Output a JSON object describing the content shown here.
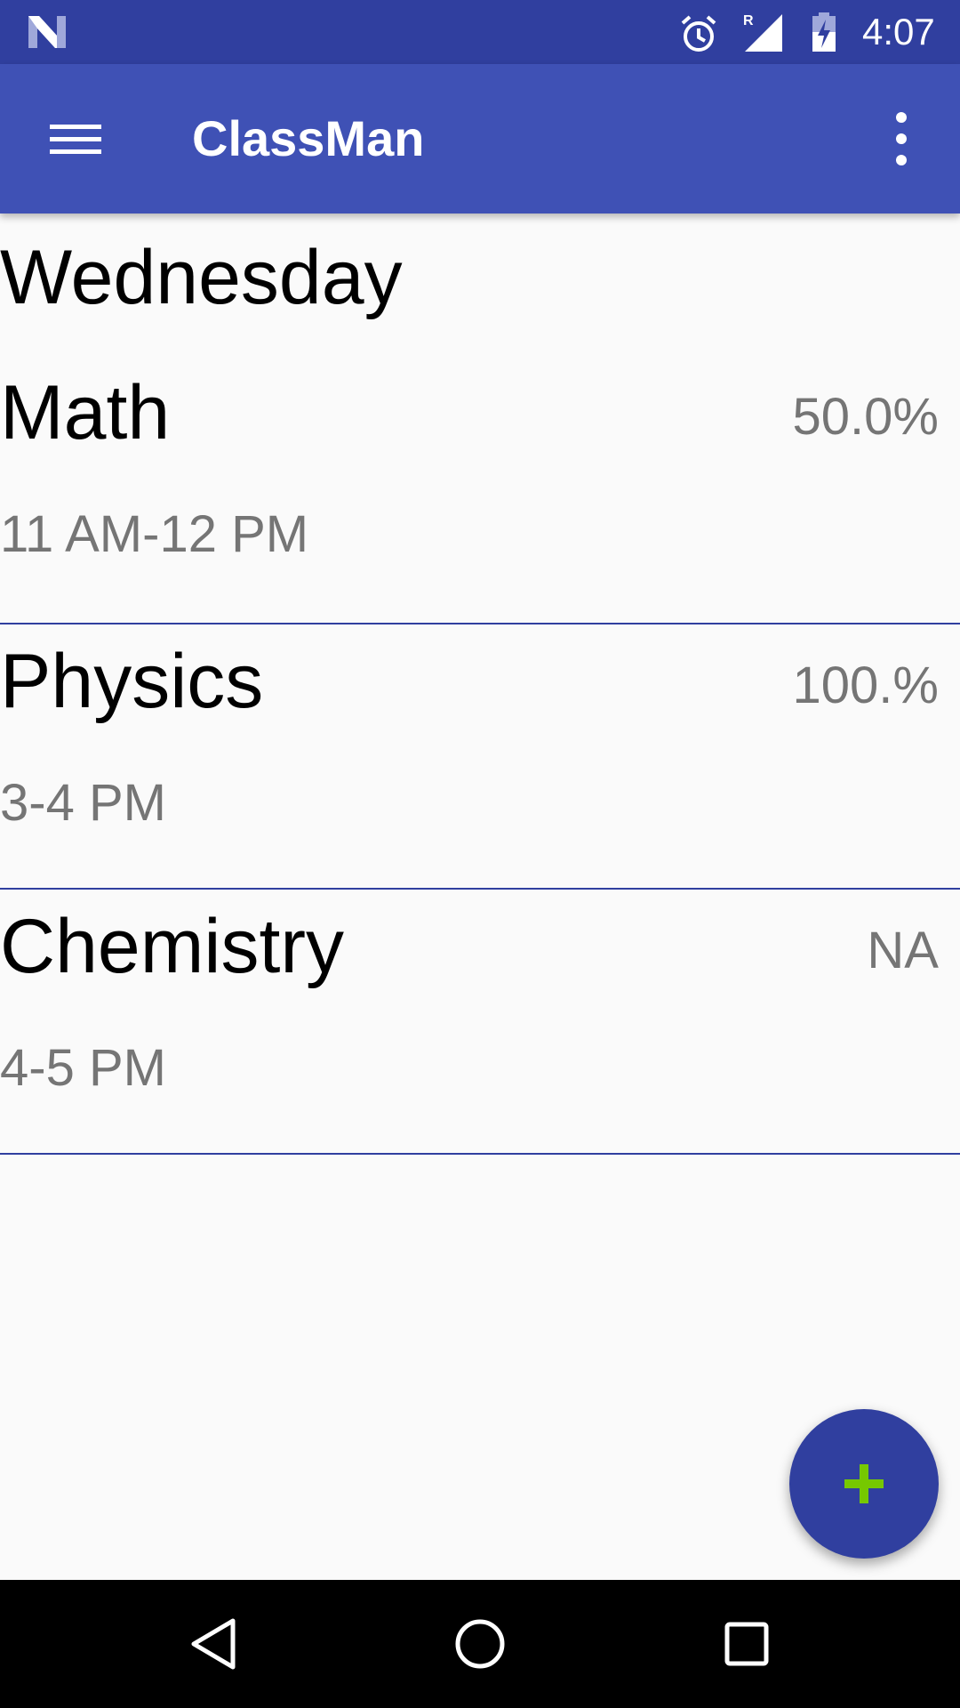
{
  "status_bar": {
    "time": "4:07",
    "icons": [
      "notification-n-icon",
      "alarm-icon",
      "signal-roaming-icon",
      "battery-charging-icon"
    ]
  },
  "app_bar": {
    "title": "ClassMan",
    "menu_icon": "hamburger-menu-icon",
    "overflow_icon": "more-vert-icon"
  },
  "day": "Wednesday",
  "classes": [
    {
      "name": "Math",
      "time": "11 AM-12 PM",
      "percent": "50.0%"
    },
    {
      "name": "Physics",
      "time": "3-4 PM",
      "percent": "100.%"
    },
    {
      "name": "Chemistry",
      "time": "4-5 PM",
      "percent": "NA"
    }
  ],
  "fab": {
    "icon": "add-icon"
  },
  "nav_bar": {
    "icons": [
      "back-icon",
      "home-icon",
      "recents-icon"
    ]
  },
  "colors": {
    "primary": "#3f51b5",
    "primary_dark": "#303f9f",
    "fab_icon": "#76c800",
    "secondary_text": "#757575",
    "background": "#fafafa"
  }
}
